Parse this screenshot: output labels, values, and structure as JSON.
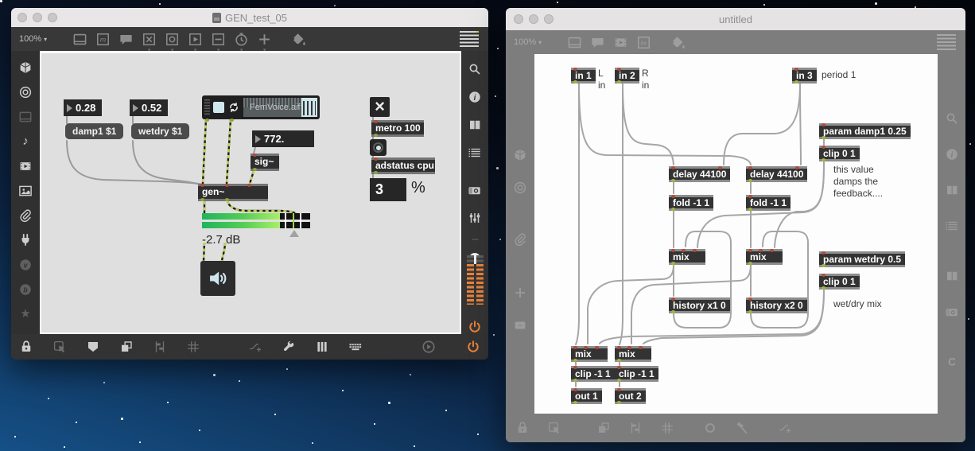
{
  "left_window": {
    "title": "GEN_test_05",
    "zoom_level": "100%",
    "toolbar_icon_names": [
      "panel-icon",
      "message-icon",
      "comment-bubble-icon",
      "toggle-box-icon",
      "object-box-icon",
      "playbar-box-icon",
      "number-box-icon",
      "metro-clock-icon",
      "add-object-icon",
      "paint-bucket-icon",
      "grid-toggle-icon"
    ],
    "left_rail_icon_names": [
      "object-browser-icon",
      "inspector-target-icon",
      "panel-icon",
      "audio-note-icon",
      "video-film-icon",
      "image-icon",
      "attachment-clip-icon",
      "plug-icon",
      "vizzie-icon",
      "beap-icon",
      "favorites-star-icon"
    ],
    "right_rail_icon_names": [
      "search-icon",
      "info-icon",
      "columns-icon",
      "console-list-icon",
      "snapshot-camera-icon",
      "mixer-sliders-icon",
      "volume-slider",
      "level-meters",
      "audio-power-icon"
    ],
    "bottom_icon_names": [
      "lock-icon",
      "select-cursor-icon",
      "presentation-icon",
      "layers-icon",
      "align-icon",
      "grid-icon",
      "patchcord-add-icon",
      "wrench-icon",
      "piano-keys-icon",
      "keyboard-icon",
      "play-circle-icon",
      "power-icon"
    ],
    "patch": {
      "num_damp": "0.28",
      "num_wetdry": "0.52",
      "msg_damp": "damp1 $1",
      "msg_wetdry": "wetdry $1",
      "playbar_filename": "FemVoice.aif",
      "num_freq": "772.",
      "obj_sig": "sig~",
      "obj_gen": "gen~",
      "gain_label": "-2.7 dB",
      "obj_metro": "metro 100",
      "obj_adstatus": "adstatus cpu",
      "num_cpu": "3",
      "comment_percent": "%"
    }
  },
  "right_window": {
    "title": "untitled",
    "zoom_level": "100%",
    "toolbar_icon_names": [
      "panel-icon",
      "comment-bubble-icon",
      "film-box-icon",
      "codebox-de-icon",
      "paint-bucket-icon",
      "grid-toggle-icon"
    ],
    "left_rail_icon_names": [
      "object-browser-icon",
      "inspector-target-icon",
      "attachment-clip-icon",
      "add-icon",
      "tilde-box-icon"
    ],
    "right_rail_icon_names": [
      "search-icon",
      "info-icon",
      "columns-icon",
      "console-list-icon",
      "columns-icon",
      "snapshot-camera-icon",
      "c-badge-icon"
    ],
    "bottom_icon_names": [
      "lock-icon",
      "select-cursor-icon",
      "layers-icon",
      "align-icon",
      "grid-icon",
      "circle-icon",
      "hammer-icon",
      "patchcord-add-icon"
    ],
    "patch": {
      "obj_in1": "in 1",
      "comment_in1_line1": "L",
      "comment_in1_line2": "in",
      "obj_in2": "in 2",
      "comment_in2_line1": "R",
      "comment_in2_line2": "in",
      "obj_in3": "in 3",
      "comment_in3": "period 1",
      "obj_param_damp": "param damp1 0.25",
      "obj_clip_damp": "clip 0 1",
      "comment_damp": "this value damps the feedback....",
      "obj_delay_l": "delay 44100",
      "obj_delay_r": "delay 44100",
      "obj_fold_l": "fold -1 1",
      "obj_fold_r": "fold -1 1",
      "obj_mix_l": "mix",
      "obj_mix_r": "mix",
      "obj_param_wetdry": "param wetdry 0.5",
      "obj_clip_wetdry": "clip 0 1",
      "comment_wetdry": "wet/dry mix",
      "obj_history_l": "history x1 0",
      "obj_history_r": "history x2 0",
      "obj_mix_out_l": "mix",
      "obj_mix_out_r": "mix",
      "obj_clip_out_l": "clip -1 1",
      "obj_clip_out_r": "clip -1 1",
      "obj_out1": "out 1",
      "obj_out2": "out 2"
    }
  },
  "colors": {
    "meter_orange": "#e8823a",
    "power_orange": "#e8823a",
    "signal_cord_green": "#c3d24a",
    "gain_green_start": "#1fb45c",
    "gain_green_end": "#a9ef68",
    "playbar_blue": "#cfe8ee",
    "canvas_light": "#e0dfdf",
    "canvas_white": "#fdfdfd",
    "chrome_dark": "#383838",
    "chrome_gray": "#7d7d7d"
  }
}
